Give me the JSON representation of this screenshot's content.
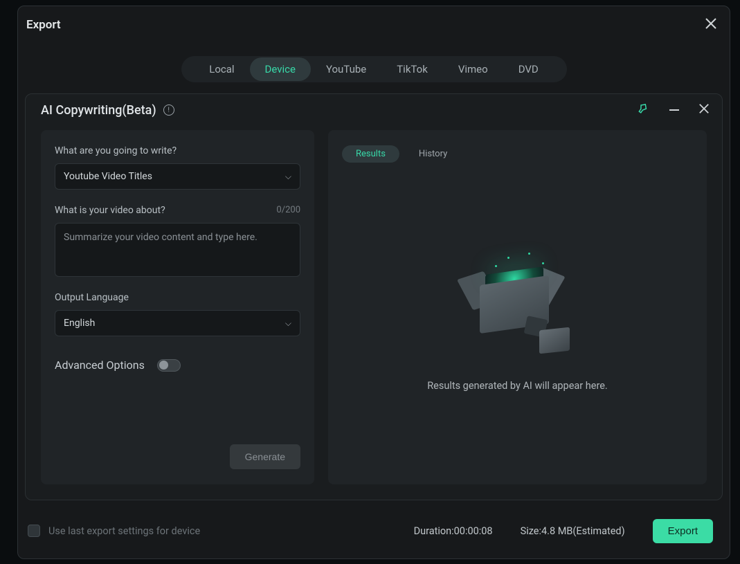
{
  "dialog": {
    "title": "Export"
  },
  "tabs": {
    "local": "Local",
    "device": "Device",
    "youtube": "YouTube",
    "tiktok": "TikTok",
    "vimeo": "Vimeo",
    "dvd": "DVD"
  },
  "panel": {
    "title": "AI Copywriting(Beta)"
  },
  "form": {
    "write_label": "What are you going to write?",
    "write_value": "Youtube Video Titles",
    "about_label": "What is your video about?",
    "about_counter": "0/200",
    "about_placeholder": "Summarize your video content and type here.",
    "lang_label": "Output Language",
    "lang_value": "English",
    "advanced_label": "Advanced Options",
    "generate": "Generate"
  },
  "results": {
    "tab_results": "Results",
    "tab_history": "History",
    "empty": "Results generated by AI will appear here."
  },
  "footer": {
    "use_last": "Use last export settings for device",
    "duration": "Duration:00:00:08",
    "size": "Size:4.8 MB(Estimated)",
    "export": "Export"
  }
}
